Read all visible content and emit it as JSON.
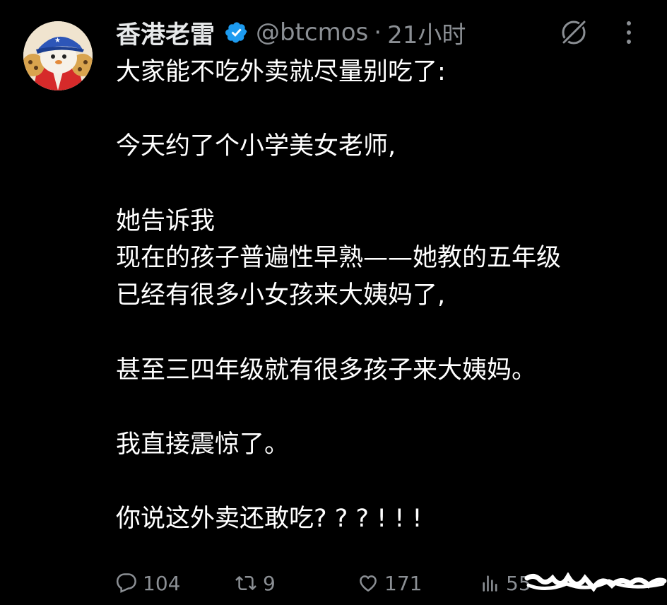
{
  "author": {
    "display_name": "香港老雷",
    "handle": "@btcmos",
    "separator": "·",
    "time": "21小时"
  },
  "post": {
    "lines": [
      "大家能不吃外卖就尽量别吃了:",
      "",
      "今天约了个小学美女老师,",
      "",
      "她告诉我",
      "现在的孩子普遍性早熟——她教的五年级",
      "已经有很多小女孩来大姨妈了,",
      "",
      "甚至三四年级就有很多孩子来大姨妈。",
      "",
      "我直接震惊了。",
      "",
      "你说这外卖还敢吃? ? ? ! ! !"
    ]
  },
  "actions": {
    "replies": "104",
    "reposts": "9",
    "likes": "171",
    "views": "55"
  },
  "icons": {
    "verified": "verified-badge-icon",
    "grok": "grok-icon",
    "more": "more-vertical-icon",
    "reply": "reply-icon",
    "repost": "repost-icon",
    "like": "heart-icon",
    "views": "views-icon"
  },
  "colors": {
    "background": "#000000",
    "text": "#ffffff",
    "muted": "#8b8f94",
    "verified": "#1d9bf0"
  }
}
